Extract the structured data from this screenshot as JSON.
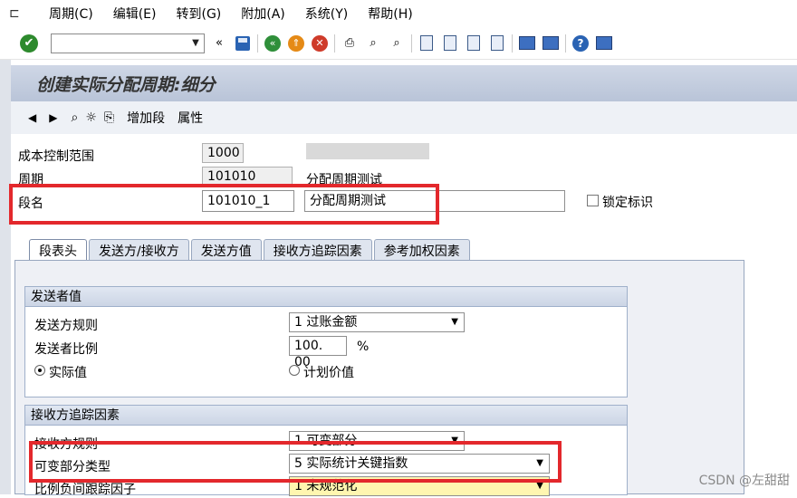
{
  "menu": {
    "icon": "menu-icon",
    "items": [
      "周期(C)",
      "编辑(E)",
      "转到(G)",
      "附加(A)",
      "系统(Y)",
      "帮助(H)"
    ]
  },
  "toolbar": {
    "command_value": "",
    "double_left": "«"
  },
  "title": "创建实际分配周期:细分",
  "app_toolbar": {
    "add_segment": "增加段",
    "attributes": "属性"
  },
  "header": {
    "controlling_area_label": "成本控制范围",
    "controlling_area_value": "1000",
    "cycle_label": "周期",
    "cycle_value": "101010",
    "cycle_text": "分配周期测试",
    "segment_label": "段名",
    "segment_value": "101010_1",
    "segment_text": "分配周期测试",
    "lock_label": "锁定标识"
  },
  "tabs": [
    "段表头",
    "发送方/接收方",
    "发送方值",
    "接收方追踪因素",
    "参考加权因素"
  ],
  "sender_values": {
    "title": "发送者值",
    "rule_label": "发送方规则",
    "rule_value": "1 过账金额",
    "share_label": "发送者比例",
    "share_value": "100. 00",
    "share_unit": "%",
    "actual_label": "实际值",
    "plan_label": "计划价值"
  },
  "receiver_tracing": {
    "title": "接收方追踪因素",
    "rule_label": "接收方规则",
    "rule_value": "1 可变部分",
    "var_type_label": "可变部分类型",
    "var_type_value": "5 实际统计关键指数",
    "scaling_label": "比例负间跟踪因子",
    "scaling_value": "1 未规范化"
  },
  "watermark": "CSDN @左甜甜"
}
